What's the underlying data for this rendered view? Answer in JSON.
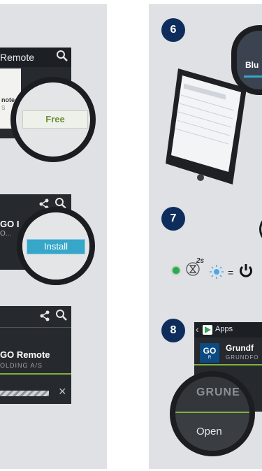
{
  "left": {
    "card1": {
      "title": "Remote",
      "free_label": "Free",
      "subtitle_a": "note",
      "subtitle_b": "S"
    },
    "card2": {
      "app_fragment": "GO I",
      "sub_fragment": "O...",
      "install_label": "Install"
    },
    "card3": {
      "app_title": "GO Remote",
      "publisher": "OLDING A/S",
      "cancel_glyph": "×"
    }
  },
  "right": {
    "step6": {
      "number": "6",
      "lens_text": "Blu"
    },
    "step7": {
      "number": "7",
      "timer_label": "2s",
      "equals": "="
    },
    "step8": {
      "number": "8",
      "bar_title": "Apps",
      "app_icon_text": "GO",
      "app_icon_sub": "R",
      "app_title": "Grundf",
      "publisher": "GRUNDFO",
      "lens_text": "GRUNE",
      "open_label": "Open"
    }
  },
  "icons": [
    "search-icon",
    "share-icon",
    "close-icon",
    "power-icon",
    "hourglass-icon",
    "play-store-icon"
  ],
  "colors": {
    "step_badge": "#0f2d5c",
    "install": "#36a6c9",
    "free_text": "#6d8f3a",
    "led_green": "#2fa84f",
    "led_blue": "#4aa8e8"
  }
}
